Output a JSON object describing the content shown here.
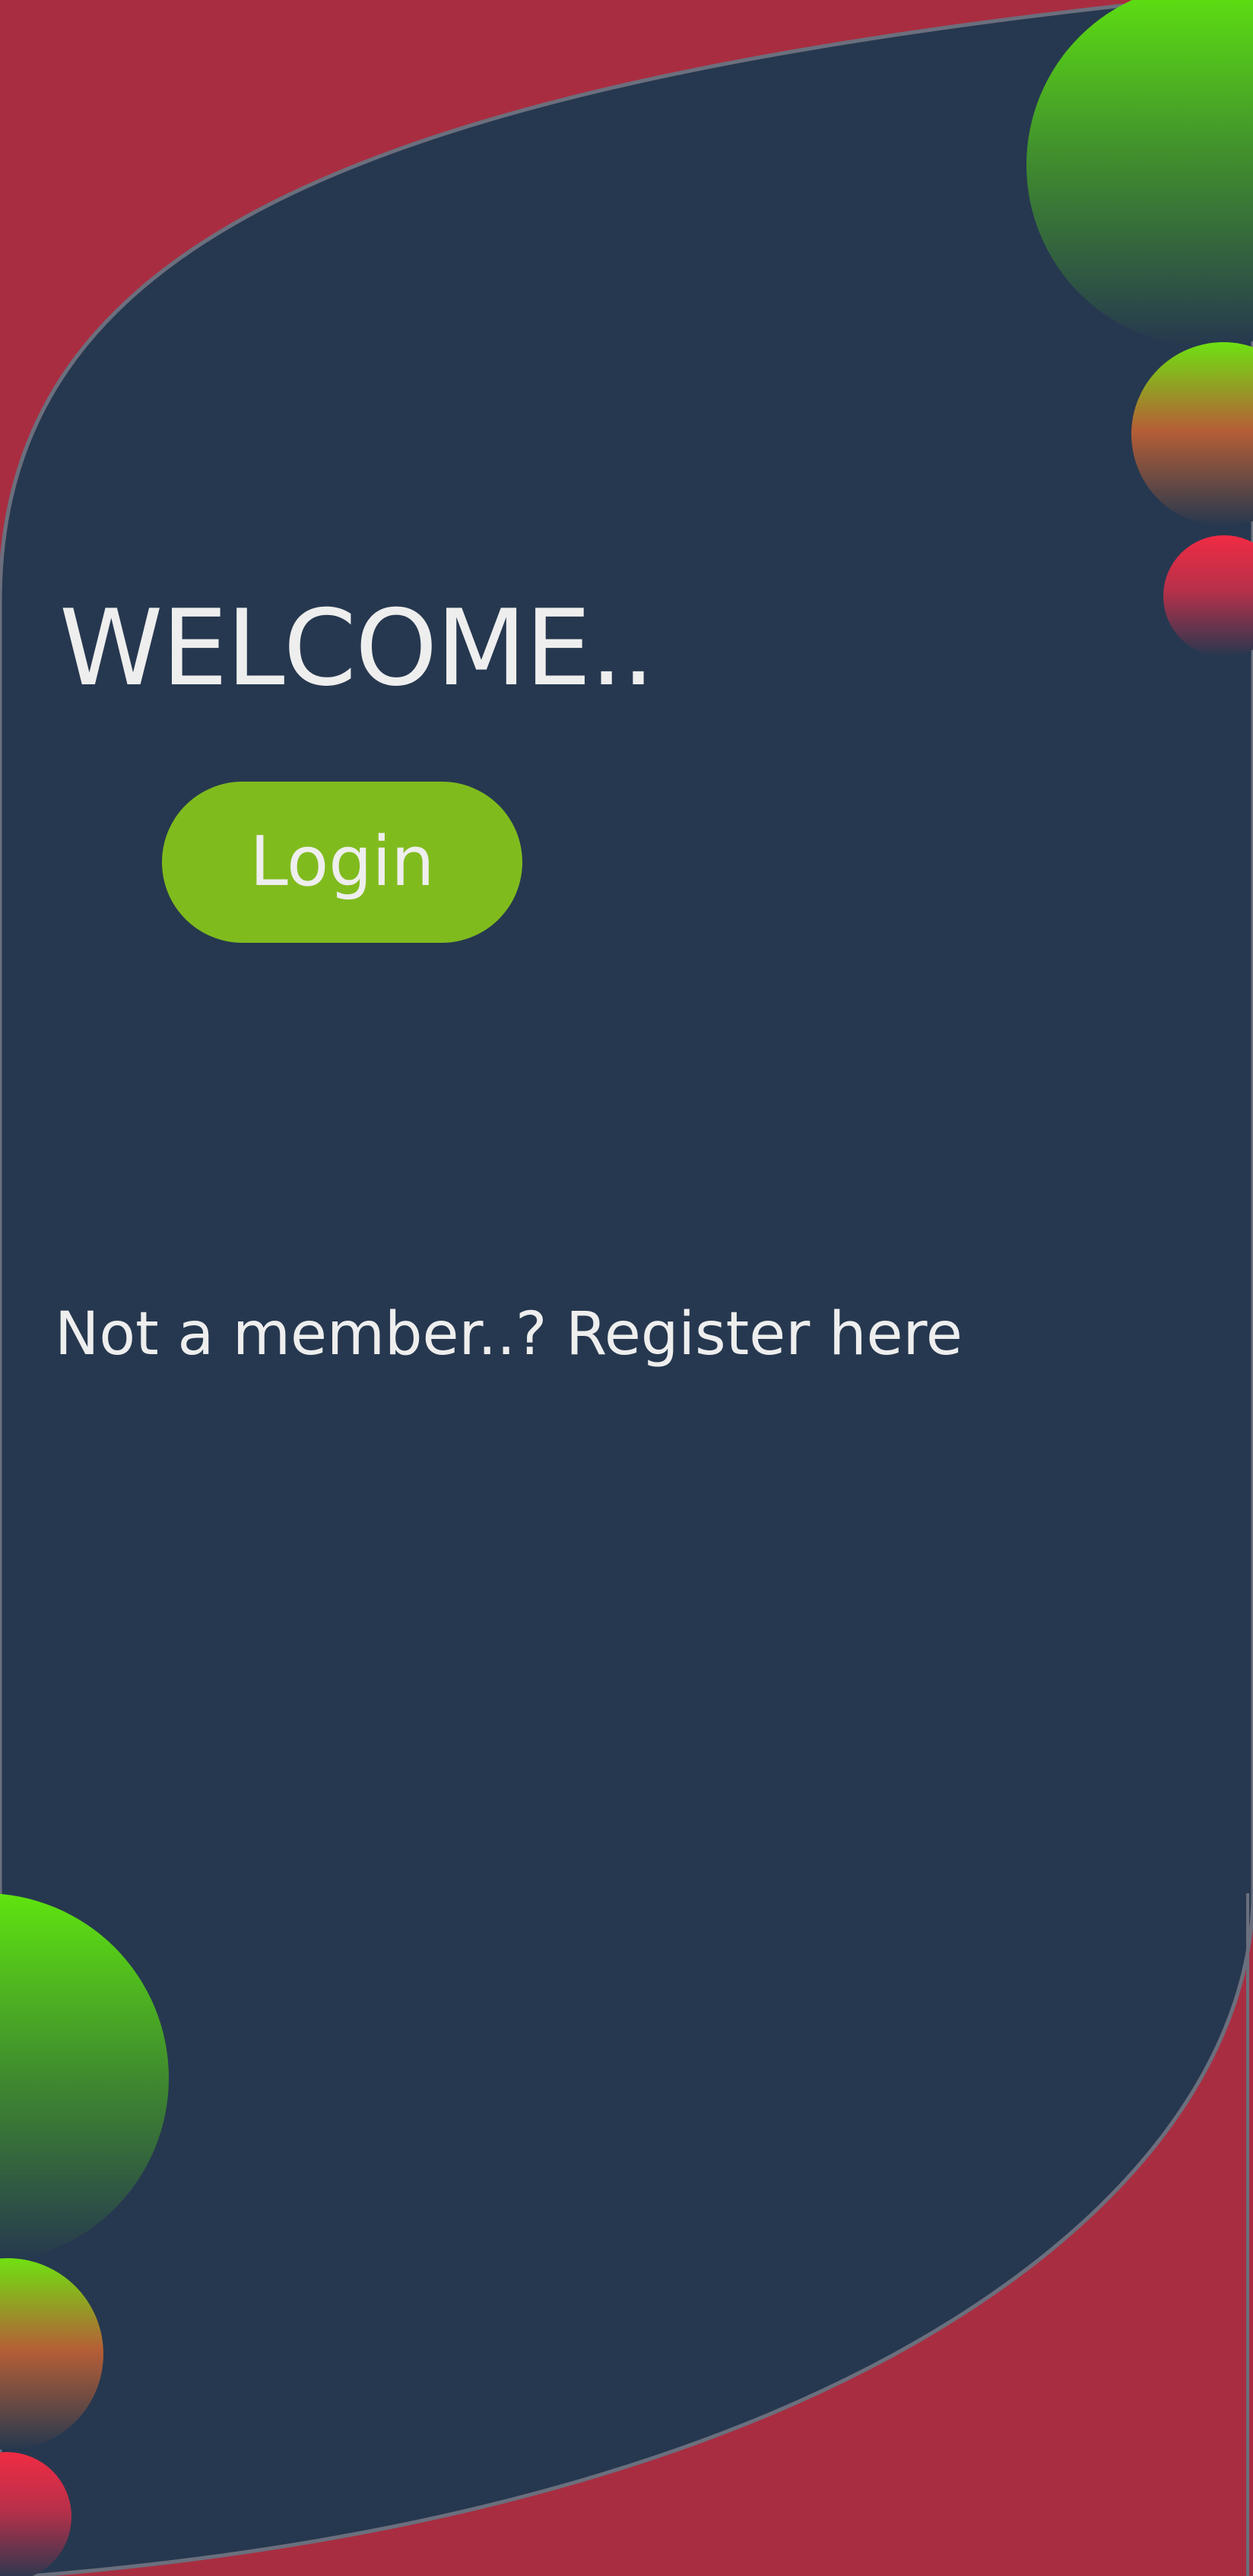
{
  "welcome": {
    "heading": "WELCOME.."
  },
  "login": {
    "label": "Login"
  },
  "register": {
    "label": "Not a member..? Register here"
  },
  "colors": {
    "background_outer": "#a92d41",
    "background_panel": "#26384f",
    "button": "#80bb1e",
    "text": "#eeeeee",
    "ball_green": "#5fe40f",
    "ball_red": "#f02b43"
  }
}
